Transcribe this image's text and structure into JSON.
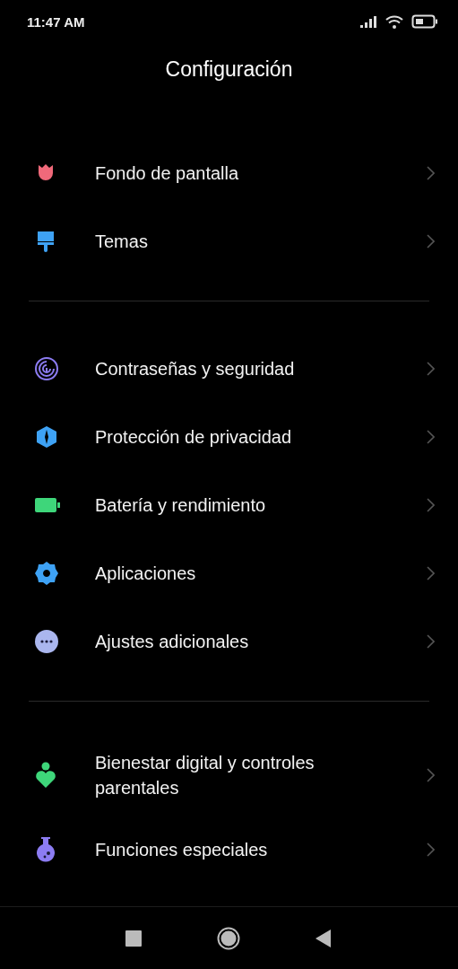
{
  "status_bar": {
    "time": "11:47 AM"
  },
  "title": "Configuración",
  "sections": [
    {
      "items": [
        {
          "kind": "tulip",
          "label": "Fondo de pantalla"
        },
        {
          "kind": "brush",
          "label": "Temas"
        }
      ]
    },
    {
      "items": [
        {
          "kind": "fingerprint",
          "label": "Contraseñas y seguridad"
        },
        {
          "kind": "shield",
          "label": "Protección de privacidad"
        },
        {
          "kind": "battery",
          "label": "Batería y rendimiento"
        },
        {
          "kind": "gear",
          "label": "Aplicaciones"
        },
        {
          "kind": "dots",
          "label": "Ajustes adicionales"
        }
      ]
    },
    {
      "items": [
        {
          "kind": "wellbeing",
          "label": "Bienestar digital y controles parentales"
        },
        {
          "kind": "flask",
          "label": "Funciones especiales"
        }
      ]
    }
  ]
}
